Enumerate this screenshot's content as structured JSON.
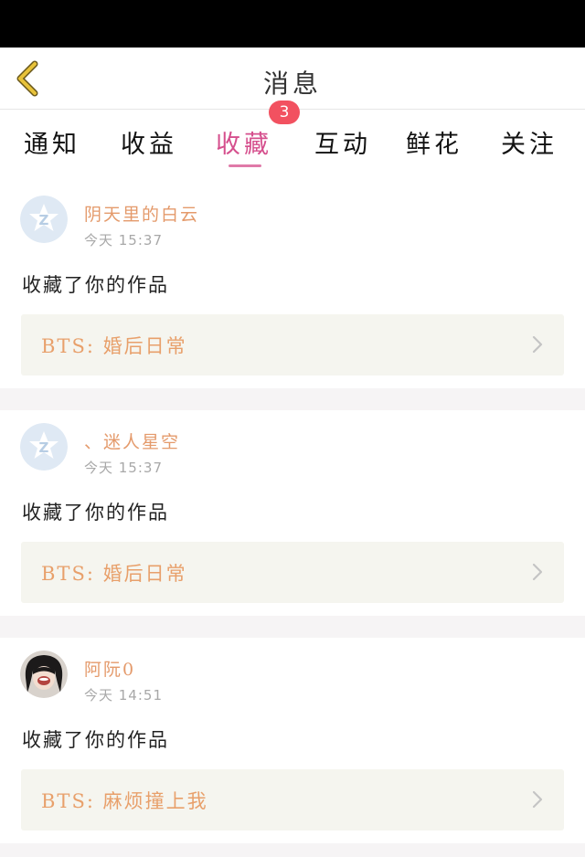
{
  "nav": {
    "title": "消息"
  },
  "tabs": [
    {
      "label": "通知",
      "active": false
    },
    {
      "label": "收益",
      "active": false
    },
    {
      "label": "收藏",
      "active": true,
      "badge": "3"
    },
    {
      "label": "互动",
      "active": false
    },
    {
      "label": "鲜花",
      "active": false
    },
    {
      "label": "关注",
      "active": false
    }
  ],
  "colors": {
    "accent": "#d54f8d",
    "username": "#e49a6b",
    "work_title": "#e8a06b",
    "badge": "#f25160"
  },
  "notifications": [
    {
      "avatar": "qq-default-avatar",
      "username": "阴天里的白云",
      "time": "今天 15:37",
      "action": "收藏了你的作品",
      "work": "BTS: 婚后日常"
    },
    {
      "avatar": "qq-default-avatar",
      "username": "、迷人星空",
      "time": "今天 15:37",
      "action": "收藏了你的作品",
      "work": "BTS: 婚后日常"
    },
    {
      "avatar": "user-photo-avatar",
      "username": "阿阮0",
      "time": "今天 14:51",
      "action": "收藏了你的作品",
      "work": "BTS: 麻烦撞上我"
    }
  ]
}
